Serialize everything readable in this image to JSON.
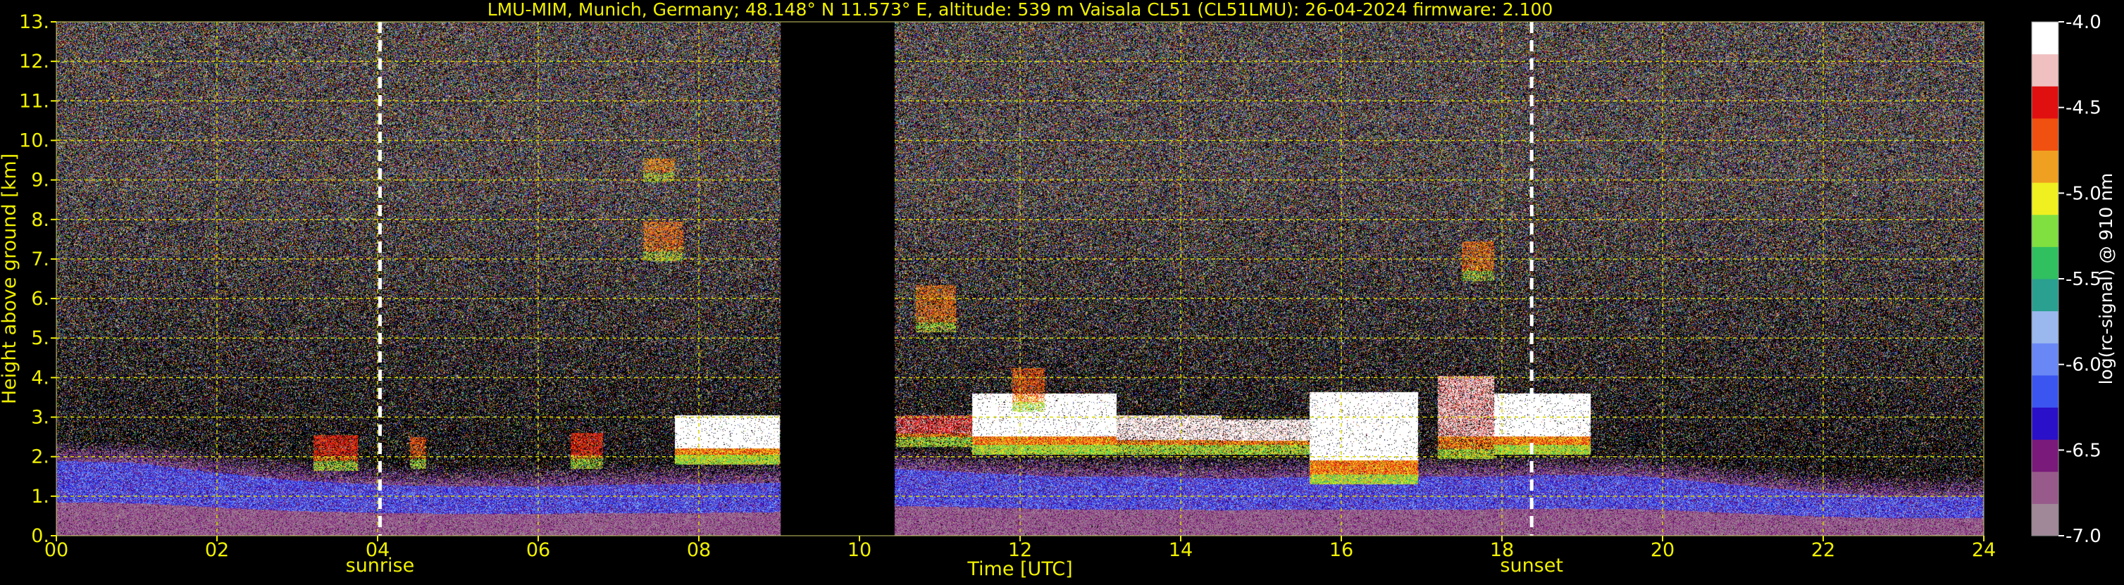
{
  "chart_data": {
    "type": "heatmap",
    "title": "LMU-MIM, Munich, Germany; 48.148° N 11.573° E, altitude: 539 m    Vaisala CL51 (CL51LMU): 26-04-2024    firmware: 2.100",
    "xlabel": "Time [UTC]",
    "ylabel": "Height above ground [km]",
    "xlim": [
      0,
      24
    ],
    "ylim": [
      0,
      13
    ],
    "x_ticks": [
      0,
      2,
      4,
      6,
      8,
      10,
      12,
      14,
      16,
      18,
      20,
      22,
      24
    ],
    "x_tick_labels": [
      "00",
      "02",
      "04",
      "06",
      "08",
      "10",
      "12",
      "14",
      "16",
      "18",
      "20",
      "22",
      "24"
    ],
    "y_ticks": [
      0,
      1,
      2,
      3,
      4,
      5,
      6,
      7,
      8,
      9,
      10,
      11,
      12,
      13
    ],
    "y_tick_labels": [
      "0.",
      "1.",
      "2.",
      "3.",
      "4.",
      "5.",
      "6.",
      "7.",
      "8.",
      "9.",
      "10.",
      "11.",
      "12.",
      "13."
    ],
    "grid": true,
    "colorbar": {
      "label": "log(rc-signal) @ 910 nm",
      "range": [
        -7.0,
        -4.0
      ],
      "ticks": [
        -7.0,
        -6.5,
        -6.0,
        -5.5,
        -5.0,
        -4.5,
        -4.0
      ],
      "tick_labels": [
        "-7.0",
        "-6.5",
        "-6.0",
        "-5.5",
        "-5.0",
        "-4.5",
        "-4.0"
      ],
      "colors": [
        "#a08898",
        "#985a8a",
        "#7a1a7a",
        "#2a10c8",
        "#3a55f0",
        "#6a88f5",
        "#9ab8ee",
        "#2aa090",
        "#30c060",
        "#80e040",
        "#f0f020",
        "#f0a020",
        "#f05010",
        "#e01010",
        "#f0c0c0",
        "#ffffff"
      ]
    },
    "markers": [
      {
        "time": 4.03,
        "label": "sunrise"
      },
      {
        "time": 18.37,
        "label": "sunset"
      }
    ],
    "no_data_intervals": [
      [
        9.02,
        10.43
      ]
    ],
    "features": {
      "aerosol_layer": [
        {
          "t0": 0.0,
          "t1": 9.02,
          "top_km": [
            1.9,
            1.85,
            1.6,
            1.4,
            1.3,
            1.25,
            1.25,
            1.3,
            1.3,
            1.35
          ]
        },
        {
          "t0": 10.43,
          "t1": 24.0,
          "top_km": [
            1.7,
            1.6,
            1.5,
            1.5,
            1.45,
            1.5,
            1.5,
            1.5,
            1.55,
            1.5,
            1.3,
            1.1,
            1.0,
            1.0
          ]
        }
      ],
      "clouds": [
        {
          "t0": 3.2,
          "t1": 3.75,
          "base_km": 1.9,
          "top_km": 2.5,
          "strength": 0.5
        },
        {
          "t0": 4.4,
          "t1": 4.6,
          "base_km": 1.95,
          "top_km": 2.45,
          "strength": 0.4
        },
        {
          "t0": 6.4,
          "t1": 6.8,
          "base_km": 1.95,
          "top_km": 2.55,
          "strength": 0.5
        },
        {
          "t0": 7.7,
          "t1": 9.0,
          "base_km": 2.05,
          "top_km": 3.0,
          "strength": 1.0
        },
        {
          "t0": 10.45,
          "t1": 11.4,
          "base_km": 2.5,
          "top_km": 3.0,
          "strength": 0.6
        },
        {
          "t0": 11.4,
          "t1": 13.2,
          "base_km": 2.3,
          "top_km": 3.55,
          "strength": 1.0
        },
        {
          "t0": 13.2,
          "t1": 14.5,
          "base_km": 2.3,
          "top_km": 3.0,
          "strength": 0.8
        },
        {
          "t0": 14.5,
          "t1": 15.6,
          "base_km": 2.3,
          "top_km": 2.9,
          "strength": 0.8
        },
        {
          "t0": 15.6,
          "t1": 16.95,
          "base_km": 1.55,
          "top_km": 3.6,
          "strength": 1.0
        },
        {
          "t0": 17.2,
          "t1": 17.9,
          "base_km": 2.2,
          "top_km": 4.0,
          "strength": 0.7
        },
        {
          "t0": 17.9,
          "t1": 19.1,
          "base_km": 2.3,
          "top_km": 3.55,
          "strength": 1.0
        },
        {
          "t0": 11.9,
          "t1": 12.3,
          "base_km": 3.4,
          "top_km": 4.2,
          "strength": 0.4
        },
        {
          "t0": 10.7,
          "t1": 11.2,
          "base_km": 5.4,
          "top_km": 6.3,
          "strength": 0.35
        },
        {
          "t0": 7.3,
          "t1": 7.8,
          "base_km": 7.2,
          "top_km": 7.9,
          "strength": 0.35
        },
        {
          "t0": 7.3,
          "t1": 7.7,
          "base_km": 9.2,
          "top_km": 9.5,
          "strength": 0.3
        },
        {
          "t0": 17.5,
          "t1": 17.9,
          "base_km": 6.7,
          "top_km": 7.4,
          "strength": 0.35
        }
      ]
    }
  }
}
